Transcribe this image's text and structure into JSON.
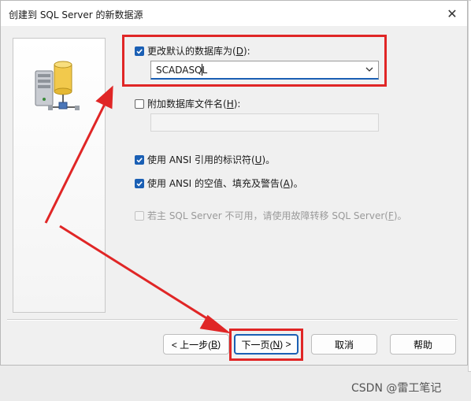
{
  "window": {
    "title": "创建到 SQL Server 的新数据源",
    "close_glyph": "✕"
  },
  "options": {
    "change_default_db": {
      "label": "更改默认的数据库为",
      "mnemonic": "D",
      "suffix": "):",
      "checked": true
    },
    "database_combo": {
      "value": "SCADASQL"
    },
    "attach_db_file": {
      "label": "附加数据库文件名",
      "mnemonic": "H",
      "suffix": "):",
      "checked": false
    },
    "ansi_quoted": {
      "label": "使用 ANSI 引用的标识符",
      "mnemonic": "U",
      "suffix": ")。",
      "checked": true
    },
    "ansi_nulls": {
      "label": "使用 ANSI 的空值、填充及警告",
      "mnemonic": "A",
      "suffix": ")。",
      "checked": true
    },
    "failover": {
      "label": "若主 SQL Server 不可用，请使用故障转移 SQL Server",
      "mnemonic": "F",
      "suffix": ")。",
      "checked": false,
      "disabled": true
    }
  },
  "buttons": {
    "back": {
      "prefix": "< 上一步(",
      "mnemonic": "B",
      "suffix": ")"
    },
    "next": {
      "prefix": "下一页(",
      "mnemonic": "N",
      "suffix": ") >"
    },
    "cancel": {
      "label": "取消"
    },
    "help": {
      "label": "帮助"
    }
  },
  "watermark": "CSDN @雷工笔记",
  "colors": {
    "accent": "#1a5fb4",
    "annotation_red": "#e02626"
  },
  "icons": [
    "database-server-icon",
    "checkmark-icon",
    "chevron-down-icon",
    "close-icon"
  ]
}
